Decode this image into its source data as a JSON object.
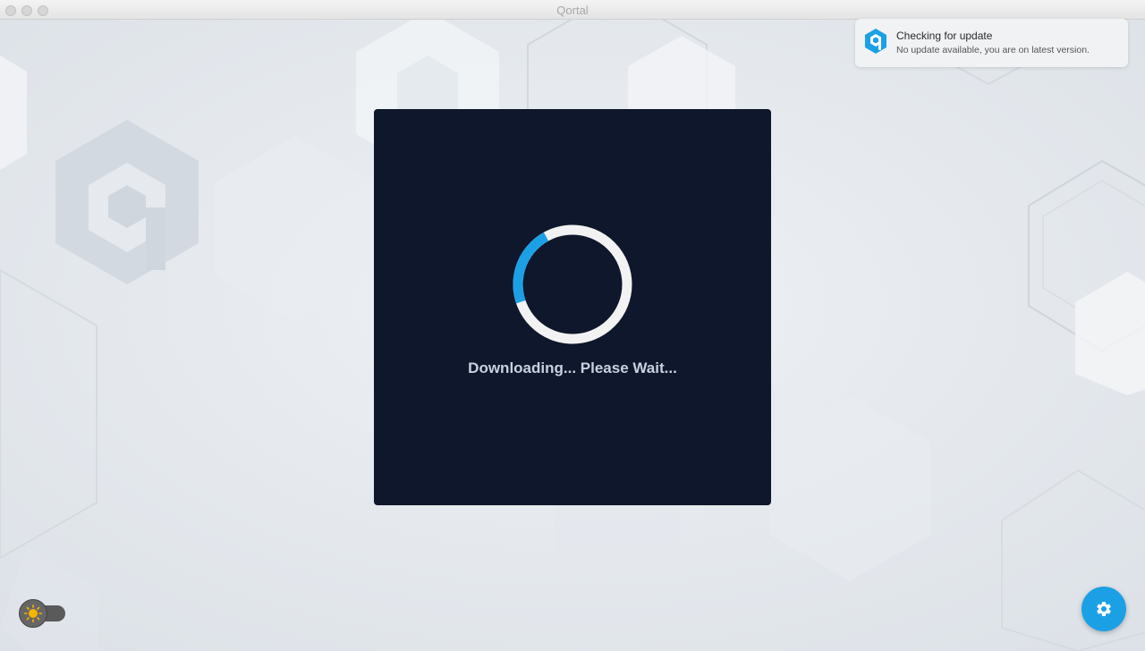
{
  "window": {
    "title": "Qortal"
  },
  "loading": {
    "text": "Downloading... Please Wait...",
    "spinner_accent": "#1ba0e6",
    "spinner_track": "#f2f2f2"
  },
  "notification": {
    "icon": "qortal-logo-icon",
    "title": "Checking for update",
    "body": "No update available, you are on latest version."
  },
  "theme_toggle": {
    "icon": "sun-icon"
  },
  "settings_button": {
    "icon": "gear-icon",
    "color": "#1ba0e6"
  }
}
